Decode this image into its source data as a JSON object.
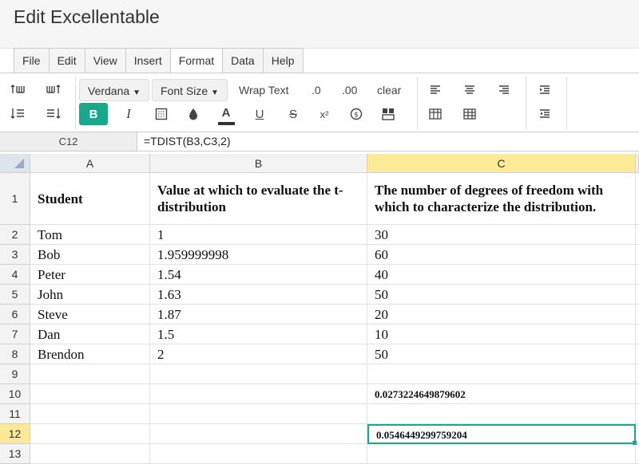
{
  "app": {
    "title": "Edit Excellentable"
  },
  "menu": [
    "File",
    "Edit",
    "View",
    "Insert",
    "Format",
    "Data",
    "Help"
  ],
  "toolbar": {
    "font_family": "Verdana",
    "font_size": "Font Size",
    "wrap_text": "Wrap Text",
    "decimal_decrease": ".0",
    "decimal_increase": ".00",
    "clear": "clear",
    "bold": "B",
    "italic": "I",
    "font_color": "A",
    "underline": "U",
    "strikethrough": "S",
    "superscript": "x²"
  },
  "formula_bar": {
    "cell_ref": "C12",
    "formula": "=TDIST(B3,C3,2)"
  },
  "columns": [
    "A",
    "B",
    "C"
  ],
  "rows": [
    {
      "num": "1",
      "a": "Student",
      "b": "Value at which to evaluate the t-distribution",
      "c": "The number of degrees of freedom with which to characterize the distribution."
    },
    {
      "num": "2",
      "a": "Tom",
      "b": "1",
      "c": "30"
    },
    {
      "num": "3",
      "a": "Bob",
      "b": "1.959999998",
      "c": "60"
    },
    {
      "num": "4",
      "a": "Peter",
      "b": "1.54",
      "c": "40"
    },
    {
      "num": "5",
      "a": "John",
      "b": "1.63",
      "c": "50"
    },
    {
      "num": "6",
      "a": "Steve",
      "b": "1.87",
      "c": "20"
    },
    {
      "num": "7",
      "a": "Dan",
      "b": "1.5",
      "c": "10"
    },
    {
      "num": "8",
      "a": "Brendon",
      "b": "2",
      "c": "50"
    },
    {
      "num": "9",
      "a": "",
      "b": "",
      "c": ""
    },
    {
      "num": "10",
      "a": "",
      "b": "",
      "c": "0.0273224649879602"
    },
    {
      "num": "11",
      "a": "",
      "b": "",
      "c": ""
    },
    {
      "num": "12",
      "a": "",
      "b": "",
      "c": "0.0546449299759204"
    },
    {
      "num": "13",
      "a": "",
      "b": "",
      "c": ""
    }
  ],
  "selected_cell": {
    "col": "C",
    "row": "12"
  }
}
